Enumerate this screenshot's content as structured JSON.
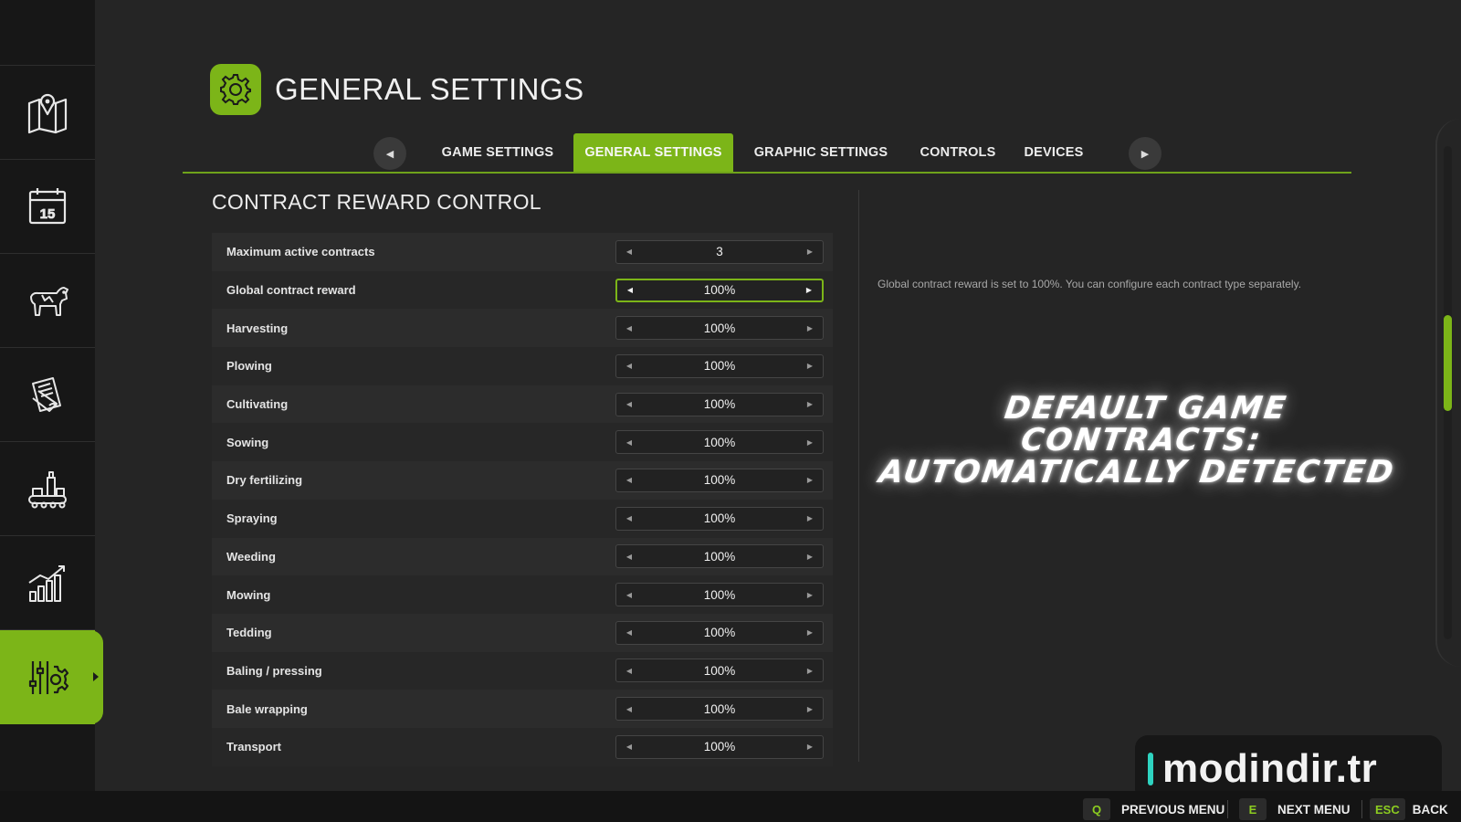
{
  "header": {
    "title": "GENERAL SETTINGS",
    "icon": "gear-icon"
  },
  "tabs": {
    "prev_icon": "◀",
    "next_icon": "▶",
    "items": [
      {
        "label": "GAME SETTINGS"
      },
      {
        "label": "GENERAL SETTINGS",
        "active": true
      },
      {
        "label": "GRAPHIC SETTINGS"
      },
      {
        "label": "CONTROLS"
      },
      {
        "label": "DEVICES"
      }
    ]
  },
  "sidebar": {
    "items": [
      {
        "icon": "map-icon"
      },
      {
        "icon": "calendar-icon",
        "day": "15"
      },
      {
        "icon": "livestock-icon"
      },
      {
        "icon": "contracts-icon"
      },
      {
        "icon": "production-icon"
      },
      {
        "icon": "statistics-icon"
      },
      {
        "icon": "settings-icon",
        "active": true
      }
    ]
  },
  "section": {
    "title": "CONTRACT REWARD CONTROL",
    "rows": [
      {
        "label": "Maximum active contracts",
        "value": "3"
      },
      {
        "label": "Global contract reward",
        "value": "100%",
        "focused": true
      },
      {
        "label": "Harvesting",
        "value": "100%"
      },
      {
        "label": "Plowing",
        "value": "100%"
      },
      {
        "label": "Cultivating",
        "value": "100%"
      },
      {
        "label": "Sowing",
        "value": "100%"
      },
      {
        "label": "Dry fertilizing",
        "value": "100%"
      },
      {
        "label": "Spraying",
        "value": "100%"
      },
      {
        "label": "Weeding",
        "value": "100%"
      },
      {
        "label": "Mowing",
        "value": "100%"
      },
      {
        "label": "Tedding",
        "value": "100%"
      },
      {
        "label": "Baling / pressing",
        "value": "100%"
      },
      {
        "label": "Bale wrapping",
        "value": "100%"
      },
      {
        "label": "Transport",
        "value": "100%"
      }
    ]
  },
  "description": "Global contract reward is set to 100%. You can configure each contract type separately.",
  "overlay": {
    "line1": "DEFAULT GAME",
    "line2": "CONTRACTS:",
    "line3": "AUTOMATICALLY DETECTED"
  },
  "watermark": {
    "text": "modindir.tr"
  },
  "footer": {
    "prev": {
      "key": "Q",
      "label": "PREVIOUS MENU"
    },
    "next": {
      "key": "E",
      "label": "NEXT MENU"
    },
    "back": {
      "key": "ESC",
      "label": "BACK"
    }
  },
  "colors": {
    "accent": "#7cb518",
    "background": "#252525",
    "sidebar": "#171717"
  }
}
